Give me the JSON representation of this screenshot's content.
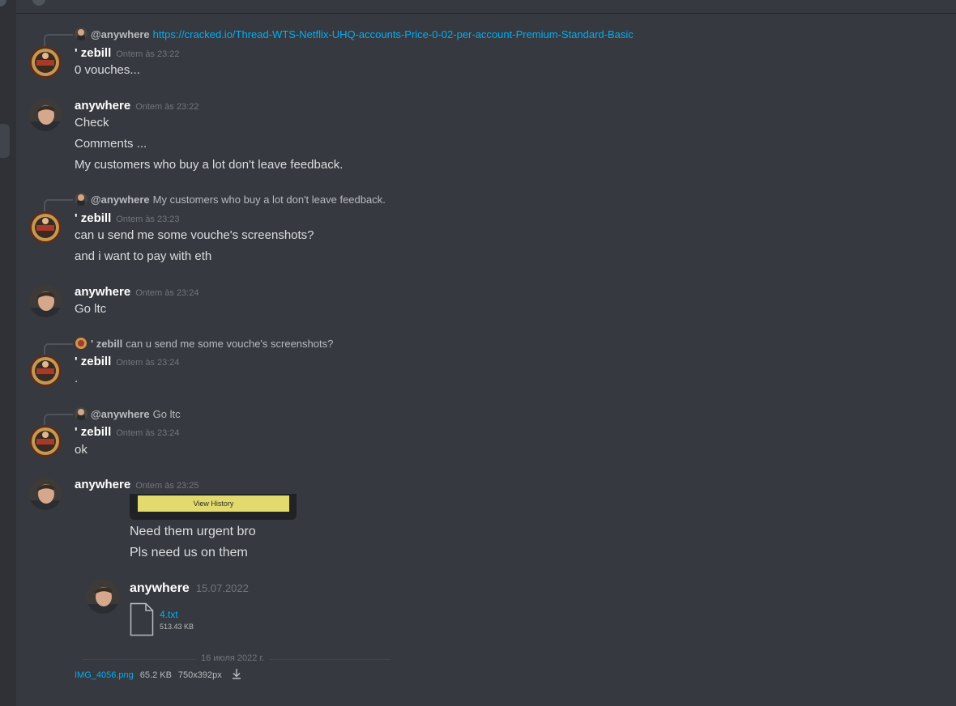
{
  "users": {
    "zebill": "' zebill",
    "anywhere": "anywhere",
    "anywhere_mention": "@anywhere"
  },
  "messages": [
    {
      "reply": {
        "name": "@anywhere",
        "text": "https://cracked.io/Thread-WTS-Netflix-UHQ-accounts-Price-0-02-per-account-Premium-Standard-Basic",
        "is_link": true
      },
      "author": "' zebill",
      "time": "Ontem às 23:22",
      "lines": [
        "0 vouches..."
      ]
    },
    {
      "author": "anywhere",
      "time": "Ontem às 23:22",
      "lines": [
        "Check",
        "Comments ...",
        "My customers who buy a lot don't leave feedback."
      ]
    },
    {
      "reply": {
        "name": "@anywhere",
        "text": "My customers who buy a lot don't leave feedback."
      },
      "author": "' zebill",
      "time": "Ontem às 23:23",
      "lines": [
        "can u send me some vouche's screenshots?",
        "and i want to pay with eth"
      ]
    },
    {
      "author": "anywhere",
      "time": "Ontem às 23:24",
      "lines": [
        "Go ltc"
      ]
    },
    {
      "reply": {
        "name": "' zebill",
        "text": "can u send me some vouche's screenshots?"
      },
      "author": "' zebill",
      "time": "Ontem às 23:24",
      "lines": [
        "."
      ]
    },
    {
      "reply": {
        "name": "@anywhere",
        "text": "Go ltc"
      },
      "author": "' zebill",
      "time": "Ontem às 23:24",
      "lines": [
        "ok"
      ]
    },
    {
      "author": "anywhere",
      "time": "Ontem às 23:25",
      "lines": []
    }
  ],
  "screenshot": {
    "button": "View History",
    "lines": [
      "Need them urgent bro",
      "Pls need us on them"
    ],
    "inner_author": "anywhere",
    "inner_time": "15.07.2022",
    "file_name": "4.txt",
    "file_size": "513.43 KB",
    "divider": "16 июля 2022 г."
  },
  "attachment": {
    "name": "IMG_4056.png",
    "size": "65.2 KB",
    "dims": "750x392px"
  },
  "colors": {
    "background": "#36393f",
    "link": "#00aff4",
    "username": "#ffffff",
    "timestamp": "#72767d",
    "view_history_button": "#e3da6d"
  },
  "icons": [
    "download-icon",
    "file-icon"
  ]
}
